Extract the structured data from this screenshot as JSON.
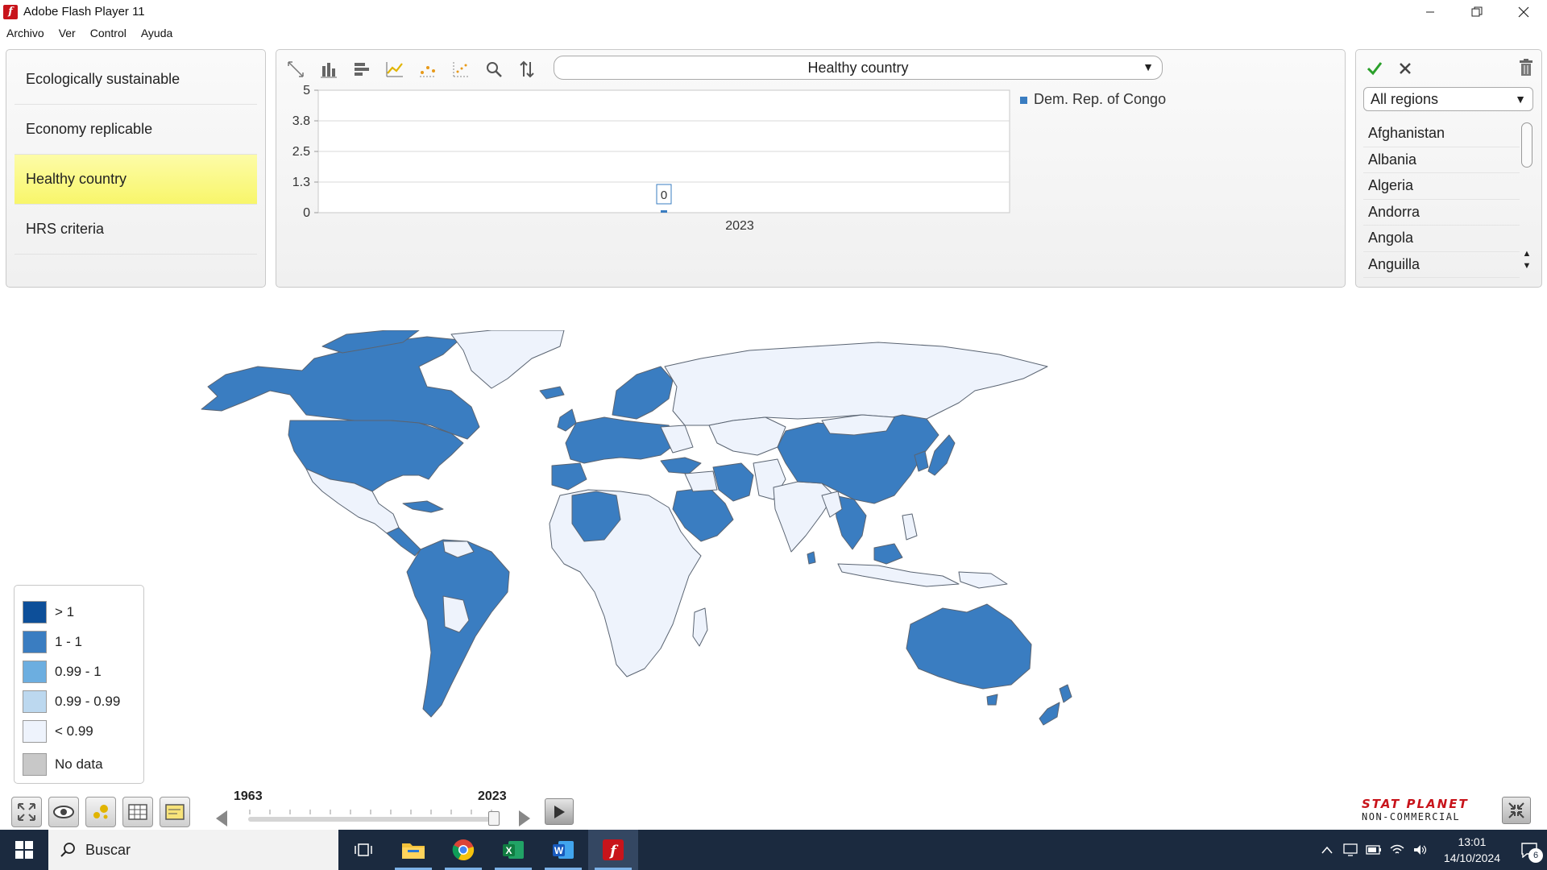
{
  "window": {
    "title": "Adobe Flash Player 11"
  },
  "menu": [
    "Archivo",
    "Ver",
    "Control",
    "Ayuda"
  ],
  "indicators": [
    {
      "label": "Ecologically sustainable",
      "selected": false
    },
    {
      "label": "Economy replicable",
      "selected": false
    },
    {
      "label": "Healthy country",
      "selected": true
    },
    {
      "label": "HRS criteria",
      "selected": false
    }
  ],
  "chart_panel": {
    "selected_indicator": "Healthy country",
    "tools": [
      "fit-icon",
      "vertical-bar-chart-icon",
      "horizontal-bar-chart-icon",
      "line-chart-icon",
      "scatter-dots-icon",
      "scatter-plot-icon",
      "zoom-icon",
      "sort-icon"
    ]
  },
  "chart_data": {
    "type": "bar",
    "categories": [
      "2023"
    ],
    "series": [
      {
        "name": "Dem. Rep. of Congo",
        "values": [
          0
        ]
      }
    ],
    "yticks": [
      "0",
      "1.3",
      "2.5",
      "3.8",
      "5"
    ],
    "ylim": [
      0,
      5
    ],
    "data_labels": [
      "0"
    ],
    "grid": true,
    "legend": "right",
    "colors": {
      "series": "#3a7dc1"
    }
  },
  "regions": {
    "selected": "All regions",
    "countries": [
      "Afghanistan",
      "Albania",
      "Algeria",
      "Andorra",
      "Angola",
      "Anguilla"
    ]
  },
  "legend": [
    {
      "label": "> 1",
      "color": "#0d4f99"
    },
    {
      "label": "1 - 1",
      "color": "#3a7dc1"
    },
    {
      "label": "0.99 - 1",
      "color": "#6caee0"
    },
    {
      "label": "0.99 - 0.99",
      "color": "#bcd8ef"
    },
    {
      "label": "< 0.99",
      "color": "#eef3fc"
    },
    {
      "label": "No data",
      "color": "#c8c8c8"
    }
  ],
  "timeline": {
    "start": "1963",
    "end": "2023"
  },
  "brand": {
    "top": "STAT PLANET",
    "bottom": "NON-COMMERCIAL"
  },
  "taskbar": {
    "search_placeholder": "Buscar",
    "time": "13:01",
    "date": "14/10/2024",
    "notifications": "6"
  },
  "map_colors": {
    "blue": "#3a7dc1",
    "light": "#eef3fc",
    "border": "#5a6472"
  }
}
